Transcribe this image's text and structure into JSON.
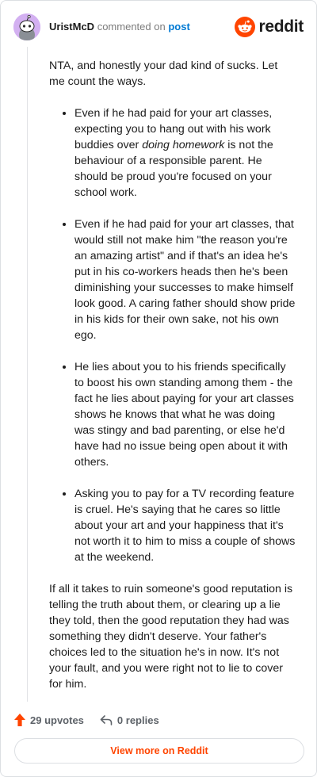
{
  "header": {
    "username": "UristMcD",
    "action": "commented on",
    "post_link": "post",
    "brand": "reddit"
  },
  "comment": {
    "intro": "NTA, and honestly your dad kind of sucks. Let me count the ways.",
    "bullets": [
      {
        "before": "Even if he had paid for your art classes, expecting you to hang out with his work buddies over ",
        "emphasis": "doing homework",
        "after": " is not the behaviour of a responsible parent. He should be proud you're focused on your school work."
      },
      {
        "text": "Even if he had paid for your art classes, that would still not make him \"the reason you're an amazing artist\" and if that's an idea he's put in his co-workers heads then he's been diminishing your successes to make himself look good. A caring father should show pride in his kids for their own sake, not his own ego."
      },
      {
        "text": "He lies about you to his friends specifically to boost his own standing among them - the fact he lies about paying for your art classes shows he knows that what he was doing was stingy and bad parenting, or else he'd have had no issue being open about it with others."
      },
      {
        "text": "Asking you to pay for a TV recording feature is cruel. He's saying that he cares so little about your art and your happiness that it's not worth it to him to miss a couple of shows at the weekend."
      }
    ],
    "closing": "If all it takes to ruin someone's good reputation is telling the truth about them, or clearing up a lie they told, then the good reputation they had was something they didn't deserve. Your father's choices led to the situation he's in now. It's not your fault, and you were right not to lie to cover for him."
  },
  "footer": {
    "upvotes": "29 upvotes",
    "replies": "0 replies",
    "view_more": "View more on Reddit"
  },
  "colors": {
    "accent": "#ff4500",
    "link": "#0079d3",
    "avatar_bg": "#d3b0f1"
  },
  "icons": {
    "avatar": "snoo-avatar-icon",
    "logo": "reddit-logo-icon",
    "upvote": "upvote-arrow-icon",
    "reply": "reply-arrow-icon"
  }
}
